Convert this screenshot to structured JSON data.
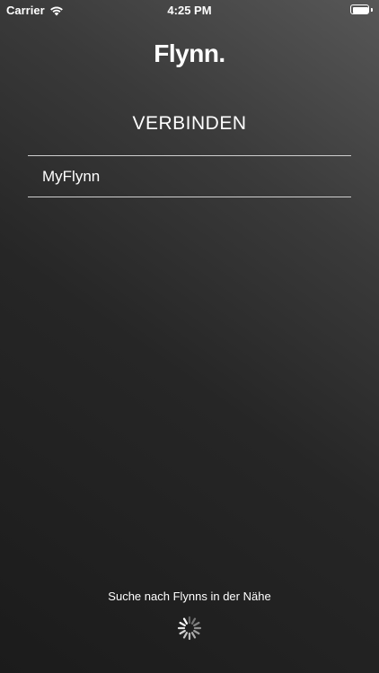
{
  "status_bar": {
    "carrier": "Carrier",
    "time": "4:25 PM",
    "wifi_icon": "wifi-icon",
    "battery_icon": "battery-icon"
  },
  "header": {
    "logo_text": "Flynn."
  },
  "main": {
    "title": "VERBINDEN",
    "devices": [
      {
        "name": "MyFlynn"
      }
    ],
    "search_status": "Suche nach Flynns in der Nähe",
    "spinner_icon": "activity-spinner-icon"
  },
  "colors": {
    "background_top": "#575757",
    "background_bottom": "#1b1b1b",
    "divider": "#cfcfcf",
    "text": "#ffffff"
  }
}
